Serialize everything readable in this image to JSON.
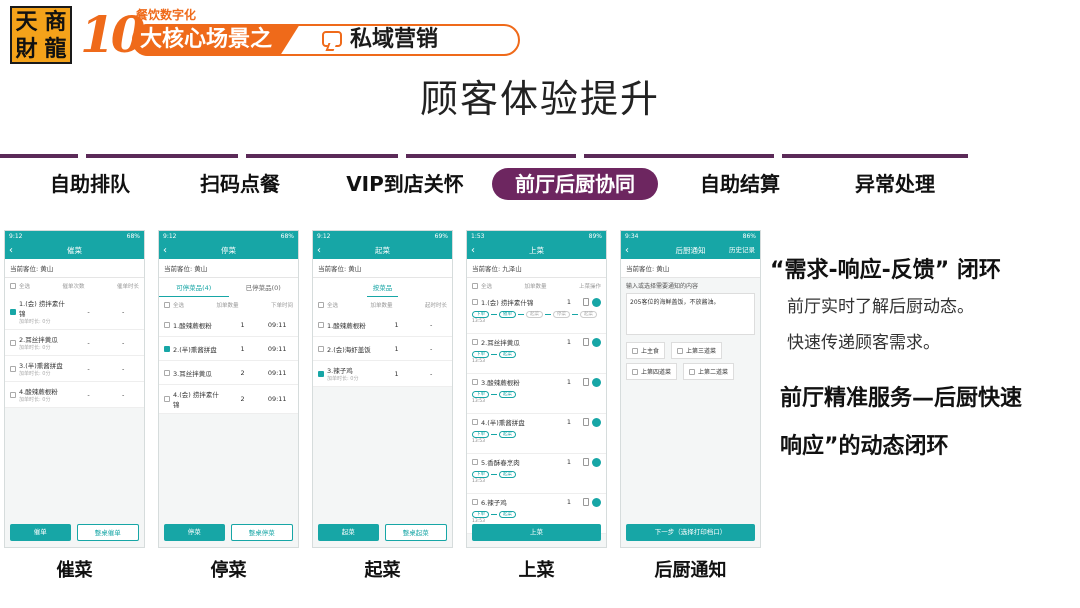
{
  "logo": {
    "chars": [
      "天",
      "商",
      "財",
      "龍"
    ]
  },
  "banner": {
    "number": "10",
    "sub": "餐饮数字化",
    "left_text": "大核心场景之",
    "right_text": "私域营销"
  },
  "title": "顾客体验提升",
  "tabs": [
    {
      "label": "自助排队"
    },
    {
      "label": "扫码点餐"
    },
    {
      "label": "VIP到店关怀"
    },
    {
      "label": "前厅后厨协同"
    },
    {
      "label": "自助结算"
    },
    {
      "label": "异常处理"
    }
  ],
  "phones": [
    {
      "caption": "催菜",
      "status_time": "9:12",
      "status_right": "68%",
      "bar_title": "催菜",
      "table": "当前客位:  黄山",
      "head": [
        "全选",
        "催单次数",
        "催单时长"
      ],
      "rows": [
        {
          "name": "1.(会) 捞拌素什锦",
          "sub": "加单时长: 0分",
          "c2": "-",
          "c3": "-",
          "checked": true
        },
        {
          "name": "2.耳丝拌黄瓜",
          "sub": "加单时长: 0分",
          "c2": "-",
          "c3": "-",
          "checked": false
        },
        {
          "name": "3.(半)熏酱拼盘",
          "sub": "加单时长: 0分",
          "c2": "-",
          "c3": "-",
          "checked": false
        },
        {
          "name": "4.酸辣蕨根粉",
          "sub": "加单时长: 0分",
          "c2": "-",
          "c3": "-",
          "checked": false
        }
      ],
      "btn_primary": "催单",
      "btn_secondary": "整桌催单"
    },
    {
      "caption": "停菜",
      "status_time": "9:12",
      "status_right": "68%",
      "bar_title": "停菜",
      "table": "当前客位:  黄山",
      "sub_tabs": [
        "可停菜品(4)",
        "已停菜品(0)"
      ],
      "head": [
        "全选",
        "加单数量",
        "下单时间"
      ],
      "rows": [
        {
          "name": "1.酸辣蕨根粉",
          "sub": "",
          "c2": "1",
          "c3": "09:11",
          "checked": false
        },
        {
          "name": "2.(半)熏酱拼盘",
          "sub": "",
          "c2": "1",
          "c3": "09:11",
          "checked": true
        },
        {
          "name": "3.耳丝拌黄瓜",
          "sub": "",
          "c2": "2",
          "c3": "09:11",
          "checked": false
        },
        {
          "name": "4.(会) 捞拌素什锦",
          "sub": "",
          "c2": "2",
          "c3": "09:11",
          "checked": false
        }
      ],
      "btn_primary": "停菜",
      "btn_secondary": "整桌停菜"
    },
    {
      "caption": "起菜",
      "status_time": "9:12",
      "status_right": "69%",
      "bar_title": "起菜",
      "table": "当前客位:  黄山",
      "sub_tabs": [
        "按菜品"
      ],
      "head": [
        "全选",
        "加单数量",
        "起时时长"
      ],
      "rows": [
        {
          "name": "1.酸辣蕨根粉",
          "sub": "",
          "c2": "1",
          "c3": "-",
          "checked": false
        },
        {
          "name": "2.(会)海虾盖饭",
          "sub": "",
          "c2": "1",
          "c3": "-",
          "checked": false
        },
        {
          "name": "3.辣子鸡",
          "sub": "加单时长: 0分",
          "c2": "1",
          "c3": "-",
          "checked": true
        }
      ],
      "btn_primary": "起菜",
      "btn_secondary": "整桌起菜"
    },
    {
      "caption": "上菜",
      "status_time": "1:53",
      "status_right": "89%",
      "bar_title": "上菜",
      "table": "当前客位:  九泽山",
      "head": [
        "全选",
        "加单数量",
        "上菜操作"
      ],
      "serve_rows": [
        {
          "name": "1.(会) 捞拌素什锦",
          "qty": "1",
          "time": "13:53",
          "steps": [
            "下单",
            "催单",
            "起菜",
            "停菜",
            "起菜"
          ]
        },
        {
          "name": "2.耳丝拌黄瓜",
          "qty": "1",
          "time": "13:53",
          "steps": [
            "下单",
            "起菜"
          ]
        },
        {
          "name": "3.酸辣蕨根粉",
          "qty": "1",
          "time": "13:53",
          "steps": [
            "下单",
            "起菜"
          ]
        },
        {
          "name": "4.(半)熏酱拼盘",
          "qty": "1",
          "time": "13:53",
          "steps": [
            "下单",
            "起菜"
          ]
        },
        {
          "name": "5.香酥春烹肉",
          "qty": "1",
          "time": "13:53",
          "steps": [
            "下单",
            "起菜"
          ]
        },
        {
          "name": "6.辣子鸡",
          "qty": "1",
          "time": "13:53",
          "steps": [
            "下单",
            "起菜"
          ]
        }
      ],
      "btn_primary": "上菜"
    },
    {
      "caption": "后厨通知",
      "status_time": "9:34",
      "status_right": "86%",
      "bar_title": "后厨通知",
      "bar_right": "历史记录",
      "table": "当前客位:  黄山",
      "prompt": "输入或选择需要通知的内容",
      "note": "205客位的海鲜盖饭，不放酱油。",
      "chips": [
        "上主食",
        "上第三道菜",
        "上第四道菜",
        "上第二道菜"
      ],
      "btn_primary": "下一步（选择打印档口）"
    }
  ],
  "right_text": {
    "heading": "“需求-响应-反馈” 闭环",
    "line1": "前厅实时了解后厨动态。",
    "line2": "快速传递顾客需求。",
    "line3": "前厅精准服务—后厨快速",
    "line4": "响应”的动态闭环"
  },
  "colors": {
    "accent": "#17a6a6",
    "brand": "#ef6a1a",
    "nav": "#6d2660"
  }
}
